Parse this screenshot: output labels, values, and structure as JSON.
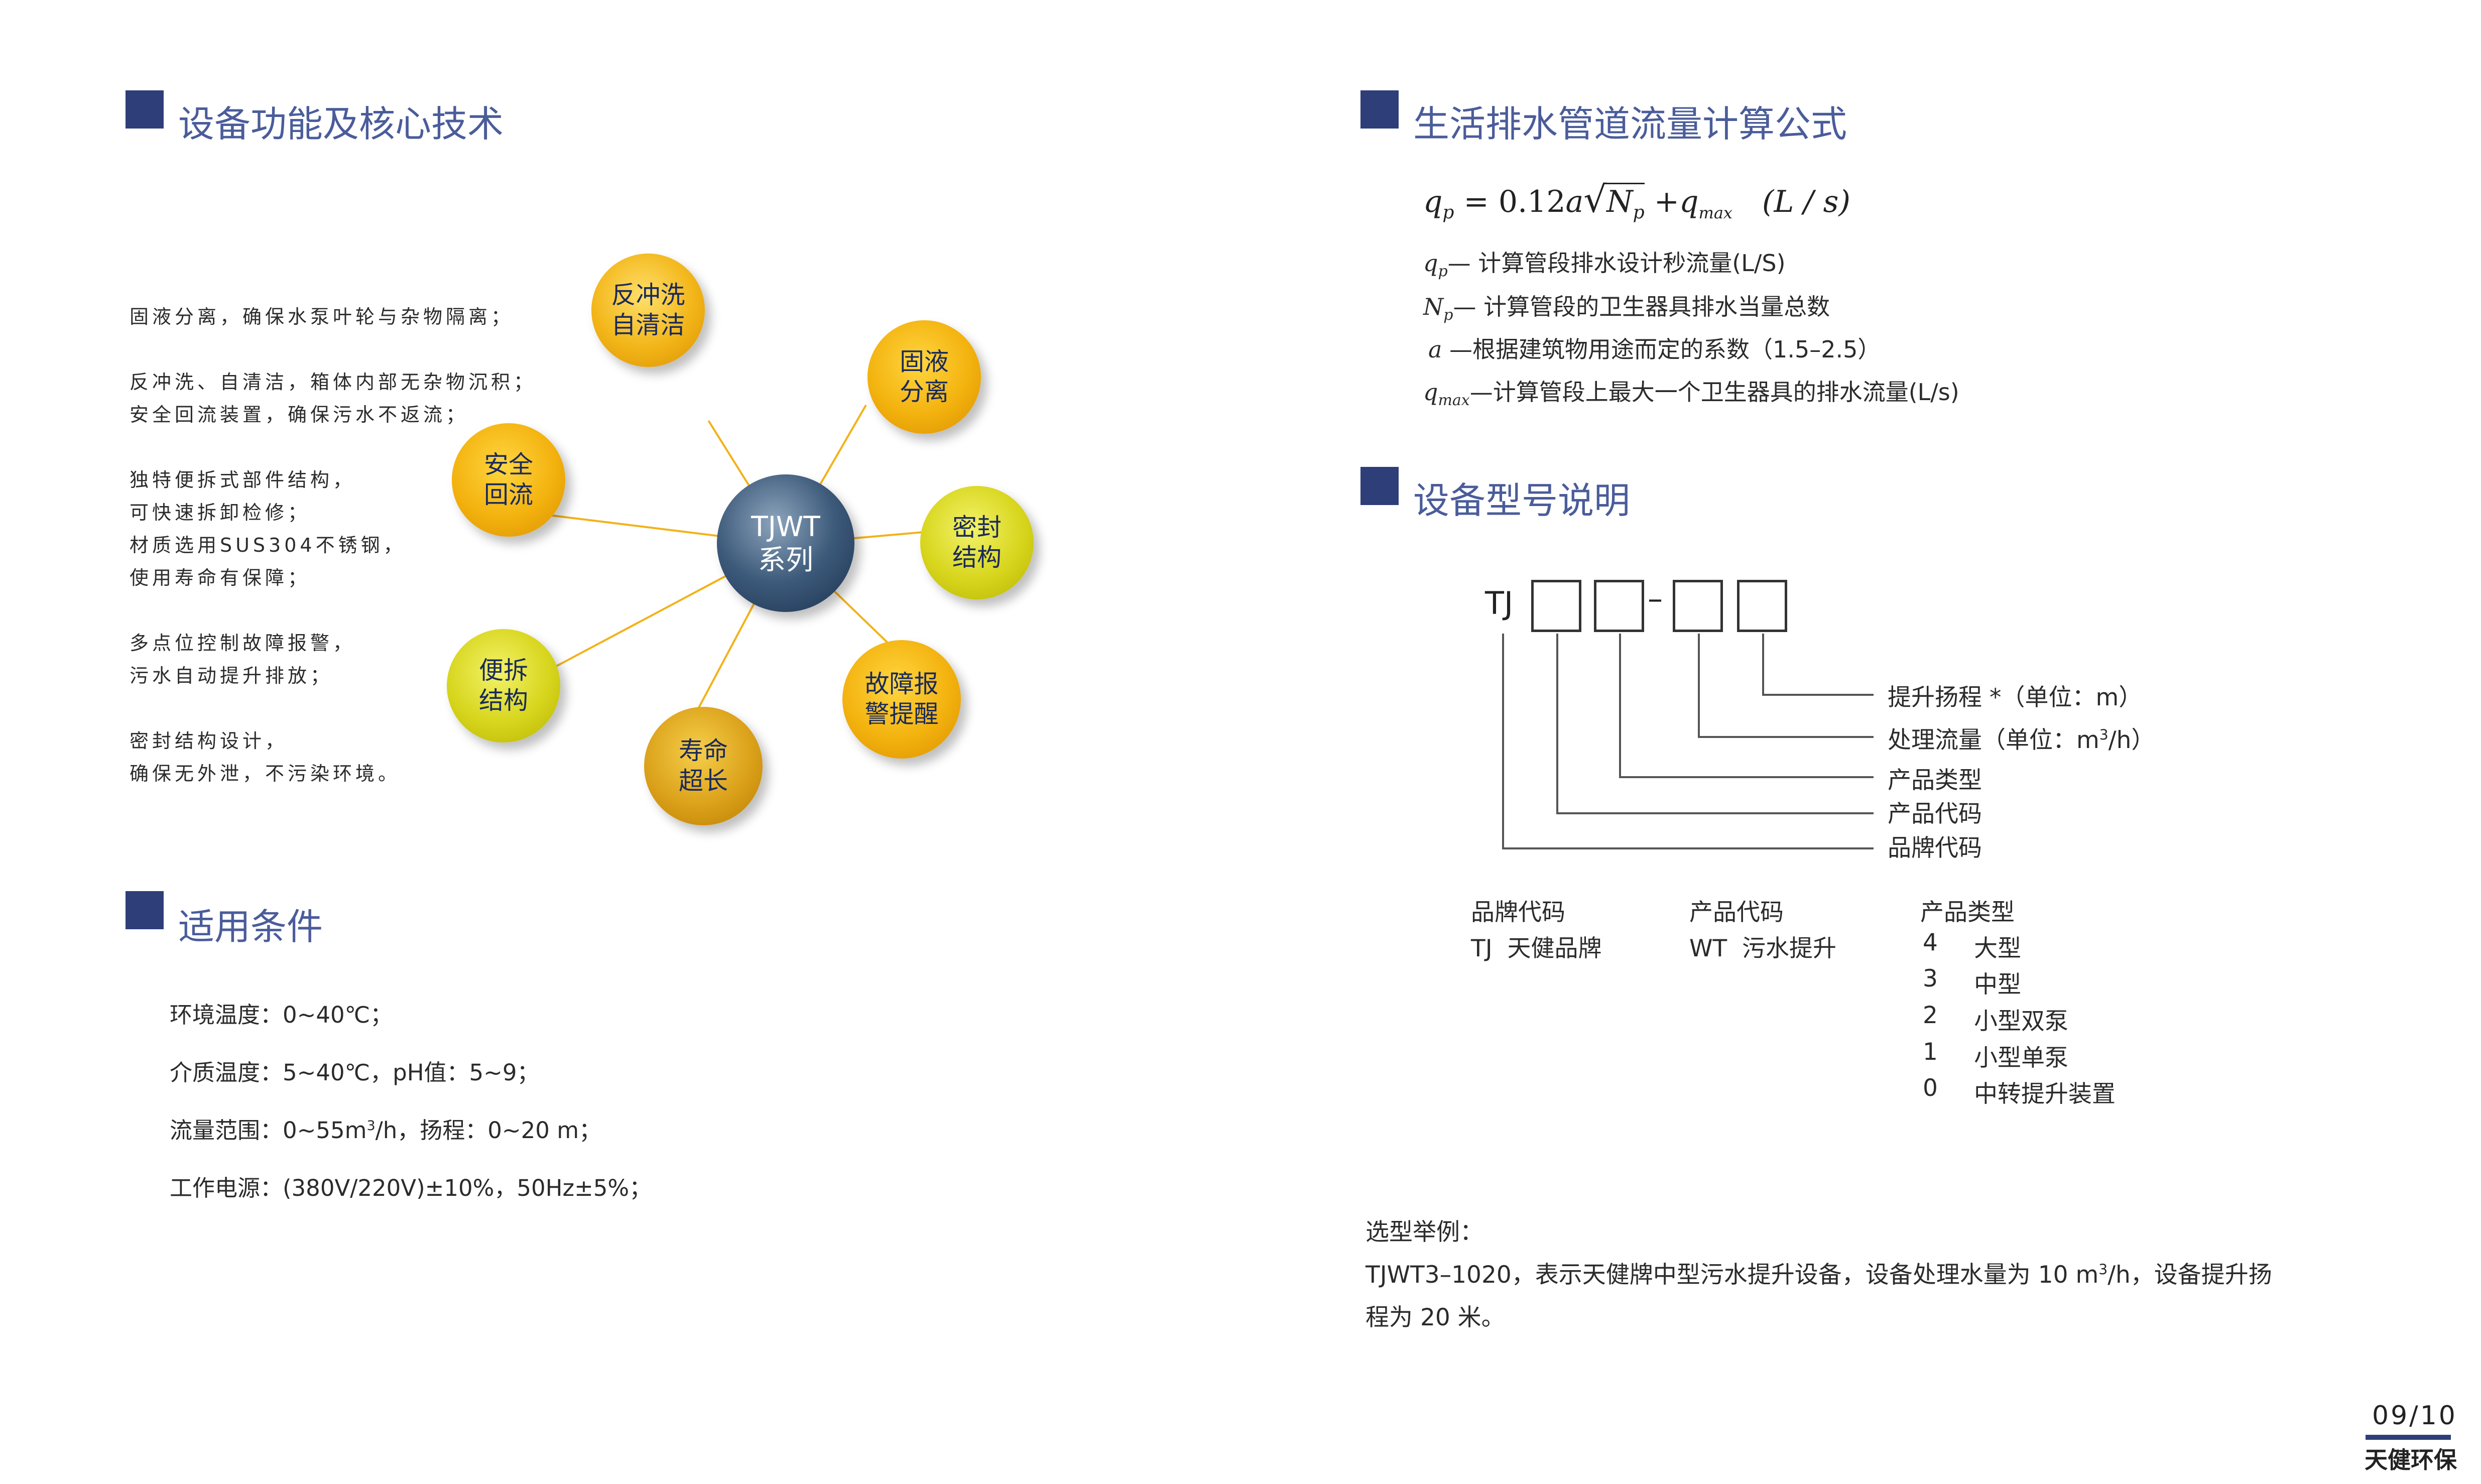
{
  "left": {
    "section_functions": {
      "title": "设备功能及核心技术"
    },
    "features": [
      "固液分离，确保水泵叶轮与杂物隔离；",
      "反冲洗、自清洁，箱体内部无杂物沉积；",
      "安全回流装置，确保污水不返流；",
      "独特便拆式部件结构，",
      "可快速拆卸检修；",
      "材质选用SUS304不锈钢，",
      "使用寿命有保障；",
      "多点位控制故障报警，",
      "污水自动提升排放；",
      "密封结构设计，",
      "确保无外泄，不污染环境。"
    ],
    "diagram": {
      "hub": "TJWT\n系列",
      "nodes": [
        {
          "label": "反冲洗\n自清洁",
          "color": "orange"
        },
        {
          "label": "固液\n分离",
          "color": "gold"
        },
        {
          "label": "安全\n回流",
          "color": "gold"
        },
        {
          "label": "密封\n结构",
          "color": "green"
        },
        {
          "label": "便拆\n结构",
          "color": "green"
        },
        {
          "label": "故障报\n警提醒",
          "color": "gold"
        },
        {
          "label": "寿命\n超长",
          "color": "dark-gold"
        }
      ]
    },
    "section_conditions": {
      "title": "适用条件"
    },
    "conditions": {
      "env_temp": "环境温度：0~40℃；",
      "medium_temp": "介质温度：5~40℃，pH值：5~9；",
      "flow_prefix": "流量范围：0~55m",
      "flow_sup": "3",
      "flow_suffix": "/h，扬程：0~20 m；",
      "power": "工作电源：(380V/220V)±10%，50Hz±5%；"
    }
  },
  "right": {
    "section_formula": {
      "title": "生活排水管道流量计算公式"
    },
    "formula": {
      "lhs": "q",
      "lhs_sub": "p",
      "eq": "= 0.12",
      "a": "a",
      "np": "N",
      "np_sub": "p",
      "plus": "+",
      "q": "q",
      "q_sub": "max",
      "unit": "(L / s)"
    },
    "definitions": [
      {
        "sym": "q",
        "sub": "p",
        "text": "— 计算管段排水设计秒流量(L/S)"
      },
      {
        "sym": "N",
        "sub": "p",
        "text": "— 计算管段的卫生器具排水当量总数"
      },
      {
        "sym": "a",
        "sub": "",
        "text": " —根据建筑物用途而定的系数（1.5–2.5）"
      },
      {
        "sym": "q",
        "sub": "max",
        "text": "—计算管段上最大一个卫生器具的排水流量(L/s)"
      }
    ],
    "section_model": {
      "title": "设备型号说明"
    },
    "model": {
      "prefix": "TJ",
      "dash": "–",
      "labels": {
        "head": "提升扬程 *（单位：m）",
        "flow_prefix": "处理流量（单位：m",
        "flow_sup": "3",
        "flow_suffix": "/h）",
        "type": "产品类型",
        "code": "产品代码",
        "brand": "品牌代码"
      }
    },
    "model_table": {
      "brand": {
        "header": "品牌代码",
        "row": "TJ  天健品牌"
      },
      "product": {
        "header": "产品代码",
        "row": "WT  污水提升"
      },
      "types": {
        "header": "产品类型",
        "rows": [
          {
            "code": "4",
            "name": "大型"
          },
          {
            "code": "3",
            "name": "中型"
          },
          {
            "code": "2",
            "name": "小型双泵"
          },
          {
            "code": "1",
            "name": "小型单泵"
          },
          {
            "code": "0",
            "name": "中转提升装置"
          }
        ]
      }
    },
    "example": {
      "title": "选型举例：",
      "line1_prefix": "TJWT3–1020，表示天健牌中型污水提升设备，设备处理水量为 10 m",
      "line1_sup": "3",
      "line1_suffix": "/h，设备提升扬",
      "line2": "程为 20 米。"
    }
  },
  "footer": {
    "page": "09/10",
    "brand": "天健环保",
    "accent": "#2e3e78"
  }
}
